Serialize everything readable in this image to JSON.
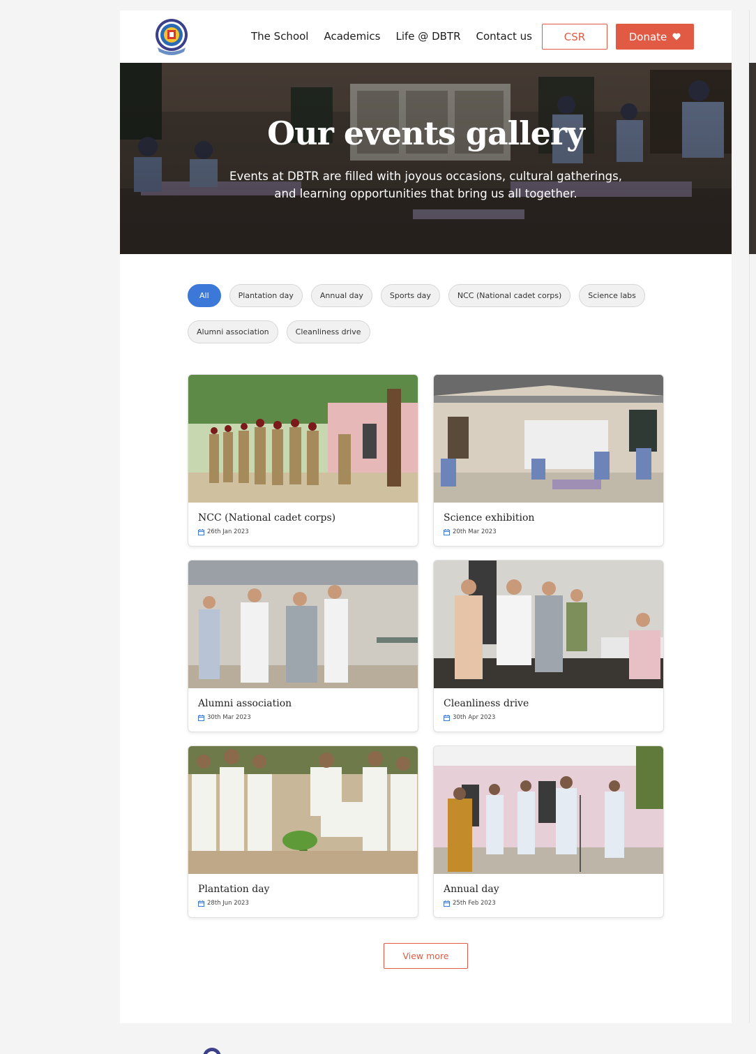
{
  "header": {
    "nav": [
      "The School",
      "Academics",
      "Life @ DBTR",
      "Contact us"
    ],
    "csr_label": "CSR",
    "donate_label": "Donate"
  },
  "hero": {
    "title": "Our events gallery",
    "subtitle": "Events at DBTR are filled with joyous occasions, cultural gatherings, and learning opportunities that bring us all together."
  },
  "filters": [
    {
      "label": "All",
      "active": true
    },
    {
      "label": "Plantation day",
      "active": false
    },
    {
      "label": "Annual day",
      "active": false
    },
    {
      "label": "Sports day",
      "active": false
    },
    {
      "label": "NCC (National cadet corps)",
      "active": false
    },
    {
      "label": "Science labs",
      "active": false
    },
    {
      "label": "Alumni association",
      "active": false
    },
    {
      "label": "Cleanliness drive",
      "active": false
    }
  ],
  "cards": [
    {
      "title": "NCC (National cadet corps)",
      "date": "26th Jan 2023"
    },
    {
      "title": "Science exhibition",
      "date": "20th Mar 2023"
    },
    {
      "title": "Alumni association",
      "date": "30th Mar 2023"
    },
    {
      "title": "Cleanliness drive",
      "date": "30th Apr 2023"
    },
    {
      "title": "Plantation day",
      "date": "28th Jun 2023"
    },
    {
      "title": "Annual day",
      "date": "25th Feb 2023"
    }
  ],
  "view_more_label": "View more",
  "colors": {
    "accent": "#e05a44",
    "active_chip": "#3b78d8",
    "calendar_icon": "#3b78d8"
  }
}
